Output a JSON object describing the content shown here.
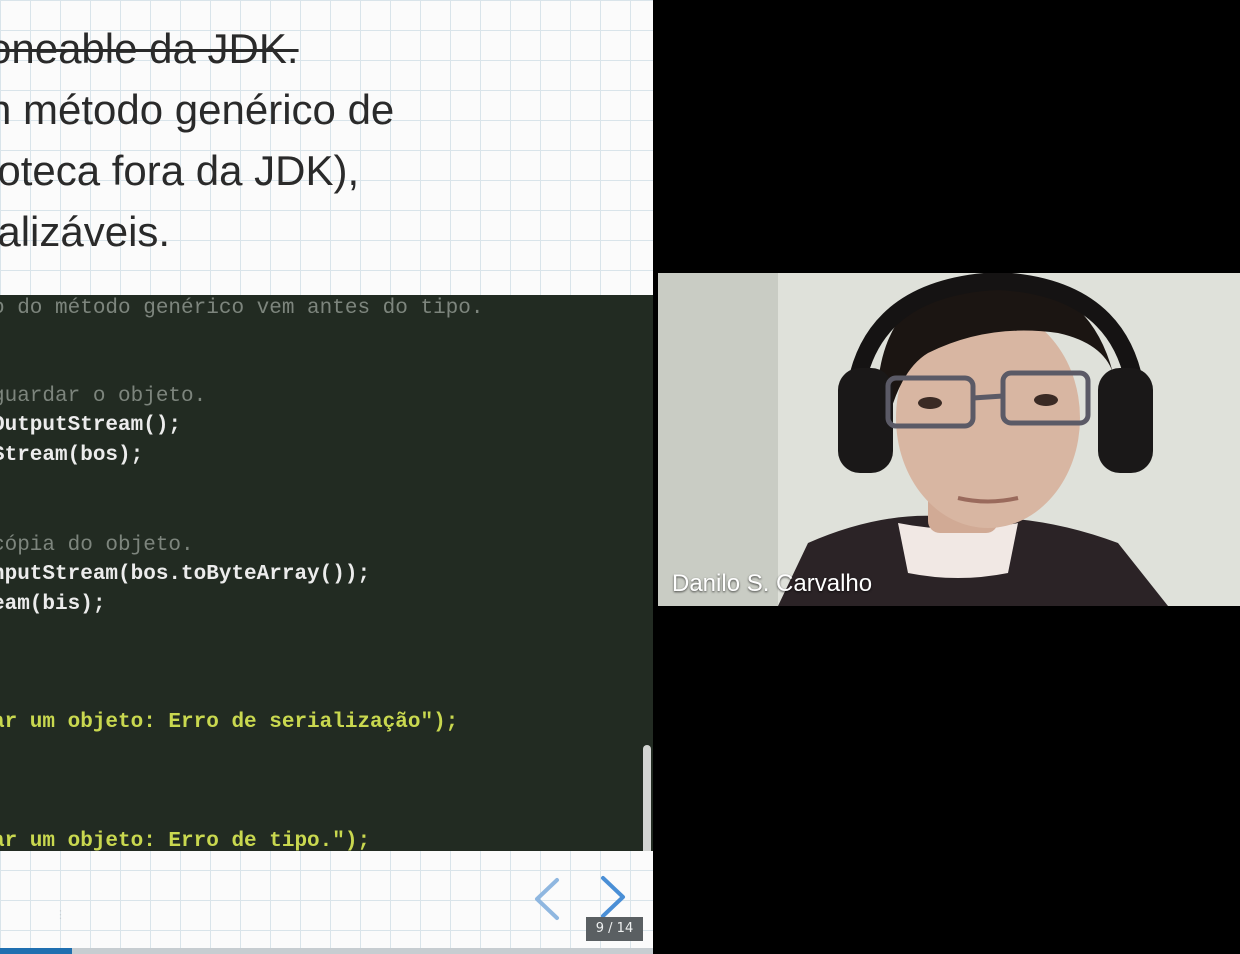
{
  "slide": {
    "text_lines": [
      {
        "text": "oneable da JDK.",
        "strike": true
      },
      {
        "text": "n método genérico de",
        "strike": false
      },
      {
        "text": "ioteca fora da JDK),",
        "strike": false
      },
      {
        "text": "ializáveis.",
        "strike": false
      }
    ],
    "code_lines": [
      {
        "text": "o do método genérico vem antes do tipo.",
        "kind": "comment"
      },
      {
        "text": "",
        "kind": "plain"
      },
      {
        "text": "",
        "kind": "plain"
      },
      {
        "text": " guardar o objeto.",
        "kind": "comment"
      },
      {
        "text": "OutputStream();",
        "kind": "code"
      },
      {
        "text": "Stream(bos);",
        "kind": "code"
      },
      {
        "text": "",
        "kind": "plain"
      },
      {
        "text": "",
        "kind": "plain"
      },
      {
        "text": "cópia do objeto.",
        "kind": "comment"
      },
      {
        "text": "nputStream(bos.toByteArray());",
        "kind": "code"
      },
      {
        "text": "eam(bis);",
        "kind": "code"
      },
      {
        "text": "",
        "kind": "plain"
      },
      {
        "text": "",
        "kind": "plain"
      },
      {
        "text": "",
        "kind": "plain"
      },
      {
        "text": "ar um objeto: Erro de serialização\");",
        "kind": "string"
      },
      {
        "text": "",
        "kind": "plain"
      },
      {
        "text": "",
        "kind": "plain"
      },
      {
        "text": "",
        "kind": "plain"
      },
      {
        "text": "ar um objeto: Erro de tipo.\");",
        "kind": "string"
      }
    ],
    "page_counter": "9 / 14",
    "progress_fraction": 0.11,
    "prev_icon": "chevron-left-icon",
    "next_icon": "chevron-right-icon"
  },
  "video": {
    "participant_name": "Danilo S. Carvalho"
  },
  "colors": {
    "code_bg": "#222b22",
    "string": "#c9d84f",
    "comment": "#7d857d",
    "nav_arrow": "#4a8fd6",
    "progress": "#1f6fb0"
  }
}
